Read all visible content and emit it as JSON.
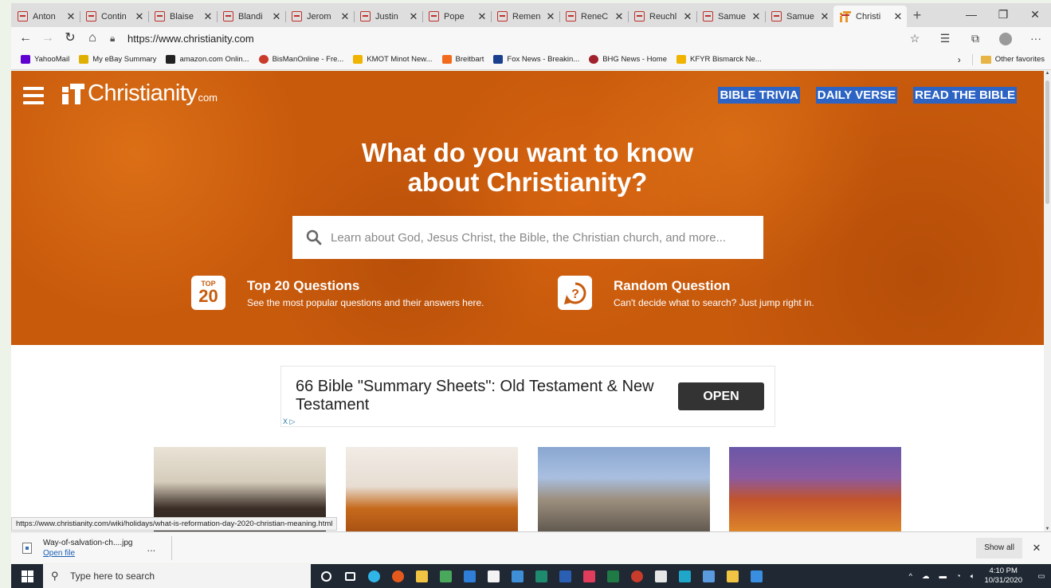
{
  "browser": {
    "tabs": [
      {
        "title": "Anton"
      },
      {
        "title": "Contin"
      },
      {
        "title": "Blaise"
      },
      {
        "title": "Blandi"
      },
      {
        "title": "Jerom"
      },
      {
        "title": "Justin"
      },
      {
        "title": "Pope"
      },
      {
        "title": "Remen"
      },
      {
        "title": "ReneC"
      },
      {
        "title": "Reuchl"
      },
      {
        "title": "Samue"
      },
      {
        "title": "Samue"
      },
      {
        "title": "Christi",
        "active": true
      }
    ],
    "new_tab": "+",
    "url": "https://www.christianity.com",
    "favorites": [
      {
        "label": "YahooMail",
        "color": "#5f01d1"
      },
      {
        "label": "My eBay Summary",
        "color": "#e0b000"
      },
      {
        "label": "amazon.com Onlin...",
        "color": "#222222"
      },
      {
        "label": "BisManOnline - Fre...",
        "color": "#c93b2b"
      },
      {
        "label": "KMOT Minot New...",
        "color": "#f0b400"
      },
      {
        "label": "Breitbart",
        "color": "#f26b1d"
      },
      {
        "label": "Fox News - Breakin...",
        "color": "#1b3f8f"
      },
      {
        "label": "BHG News - Home",
        "color": "#a0222c"
      },
      {
        "label": "KFYR Bismarck Ne...",
        "color": "#f0b400"
      }
    ],
    "other_favorites": "Other favorites"
  },
  "site": {
    "logo_name": "Christianity",
    "logo_tld": "com",
    "nav": [
      "BIBLE TRIVIA",
      "DAILY VERSE",
      "READ THE BIBLE"
    ],
    "headline_line1": "What do you want to know",
    "headline_line2": "about Christianity?",
    "search_placeholder": "Learn about God, Jesus Christ, the Bible, the Christian church, and more...",
    "promo_top20": {
      "icon_top": "TOP",
      "icon_num": "20",
      "title": "Top 20 Questions",
      "subtitle": "See the most popular questions and their answers here."
    },
    "promo_random": {
      "title": "Random Question",
      "subtitle": "Can't decide what to search? Just jump right in."
    },
    "ad": {
      "text": "66 Bible \"Summary Sheets\": Old Testament & New Testament",
      "button": "OPEN",
      "choices": "X ▷"
    },
    "accent": "#c85a0c",
    "nav_highlight": "#2d64c4"
  },
  "status_url": "https://www.christianity.com/wiki/holidays/what-is-reformation-day-2020-christian-meaning.html",
  "downloads": {
    "filename": "Way-of-salvation-ch....jpg",
    "open_label": "Open file",
    "more": "...",
    "show_all": "Show all"
  },
  "taskbar": {
    "search_placeholder": "Type here to search",
    "time": "4:10 PM",
    "date": "10/31/2020"
  }
}
